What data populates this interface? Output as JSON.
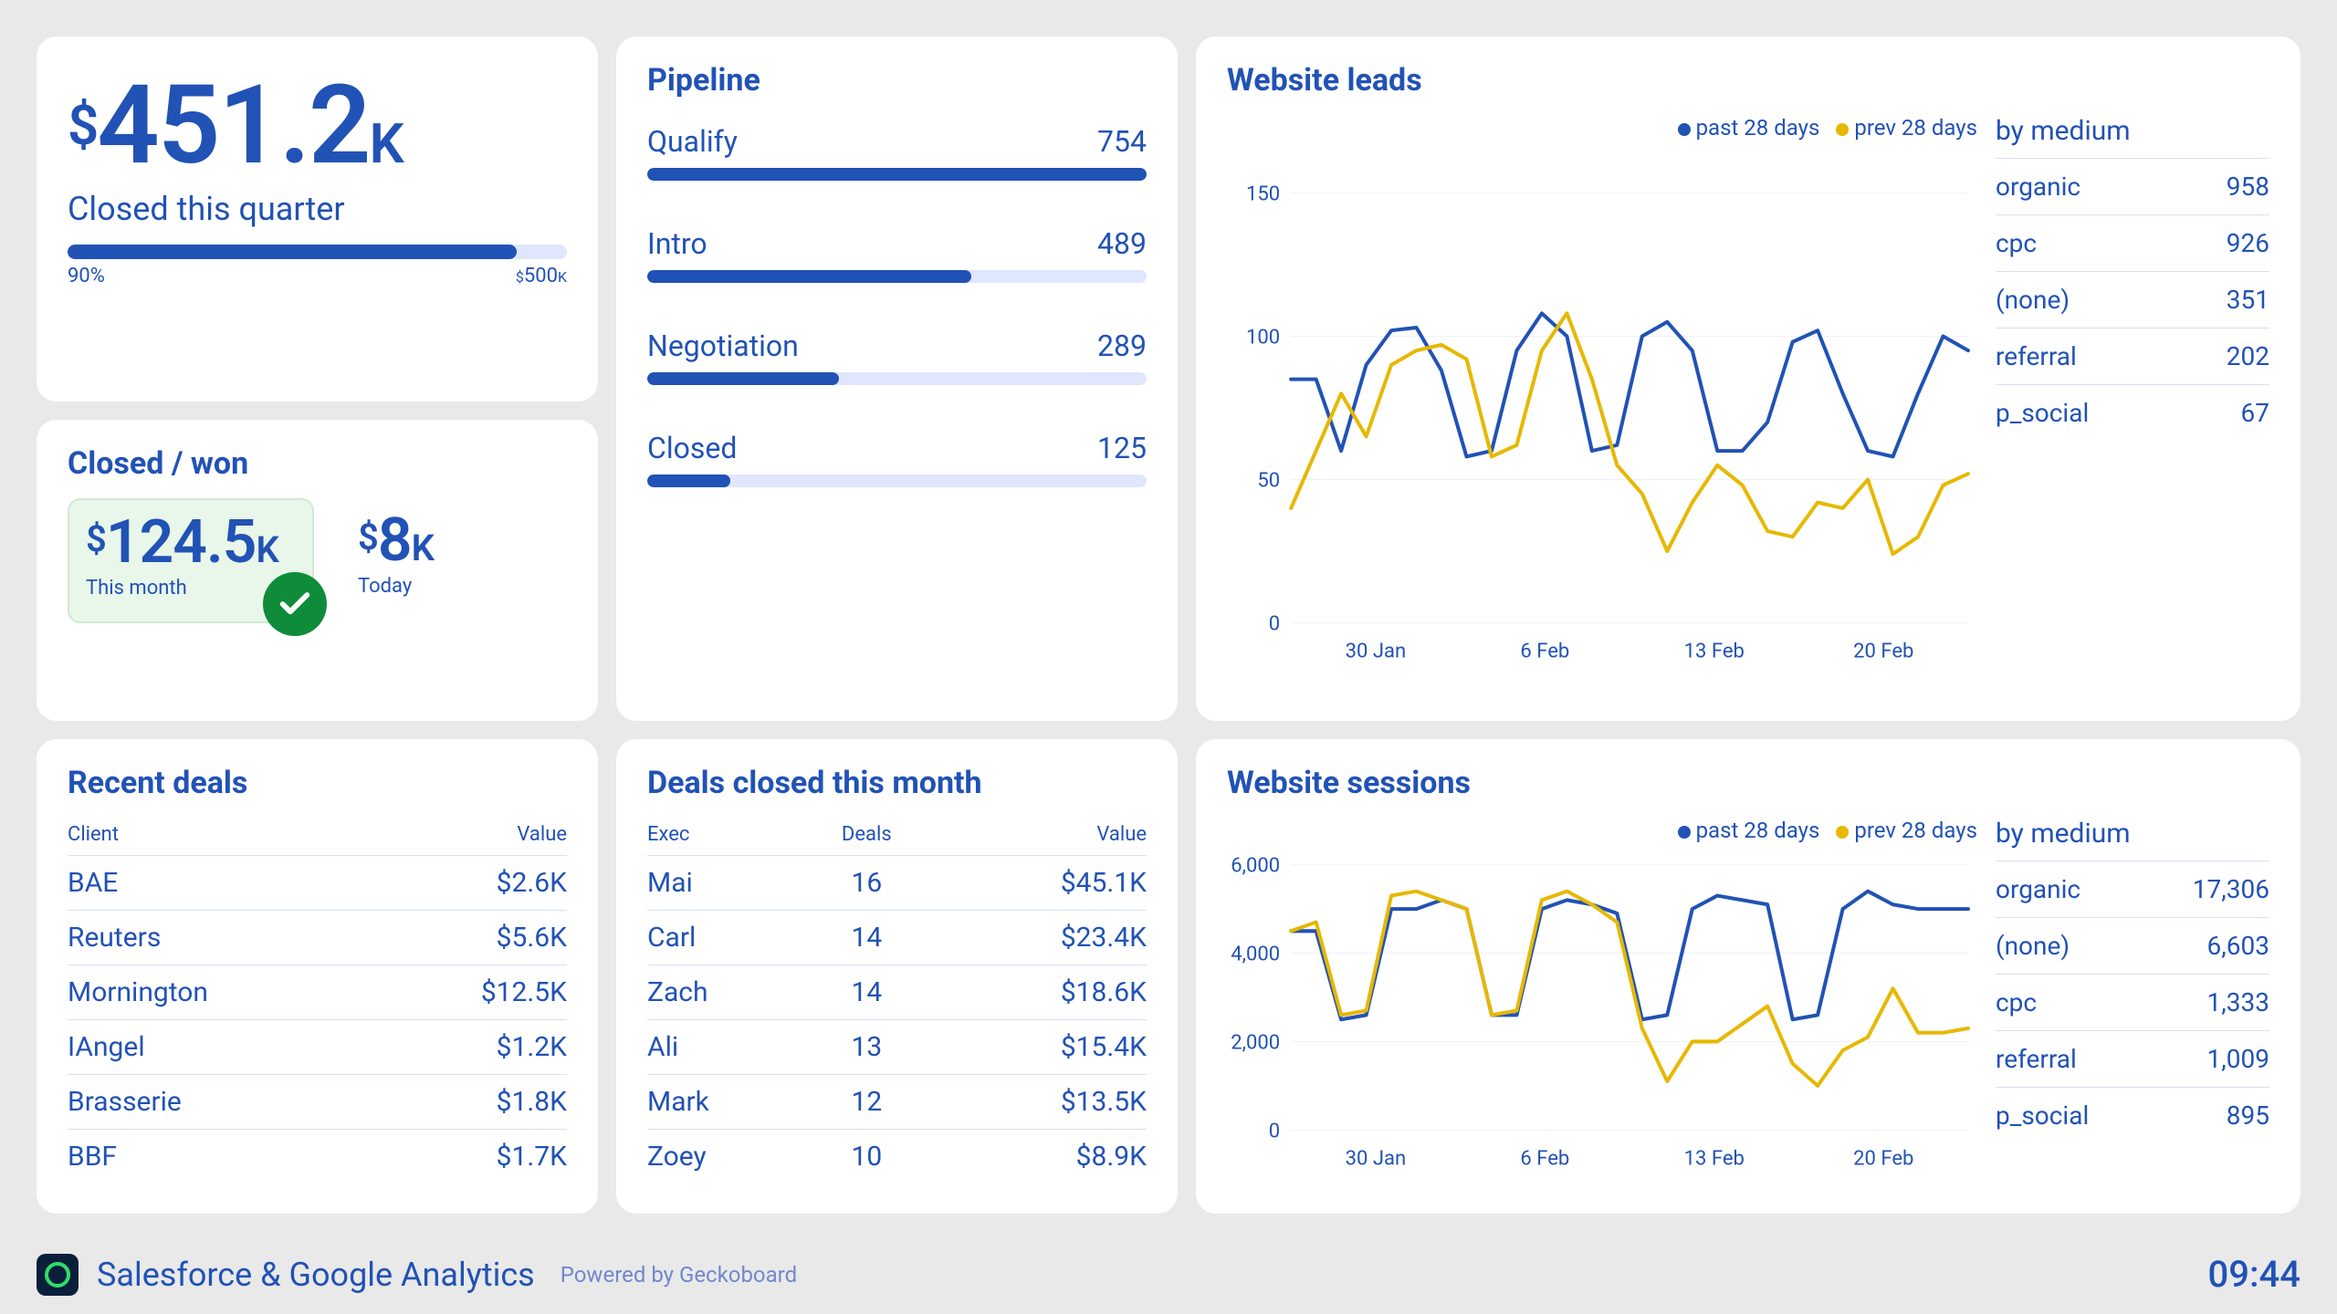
{
  "footer": {
    "title": "Salesforce & Google Analytics",
    "powered": "Powered by Geckoboard",
    "time": "09:44"
  },
  "quarter": {
    "prefix": "$",
    "value": "451.2",
    "suffix": "K",
    "caption": "Closed this quarter",
    "progress_pct": 90,
    "left_label": "90%",
    "right_prefix": "$",
    "right_value": "500",
    "right_suffix": "K"
  },
  "closed_won": {
    "title": "Closed / won",
    "month": {
      "prefix": "$",
      "value": "124.5",
      "suffix": "K",
      "label": "This month"
    },
    "today": {
      "prefix": "$",
      "value": "8",
      "suffix": "K",
      "label": "Today"
    }
  },
  "recent": {
    "title": "Recent deals",
    "columns": [
      "Client",
      "Value"
    ],
    "rows": [
      {
        "client": "BAE",
        "value": "$2.6K"
      },
      {
        "client": "Reuters",
        "value": "$5.6K"
      },
      {
        "client": "Mornington",
        "value": "$12.5K"
      },
      {
        "client": "IAngel",
        "value": "$1.2K"
      },
      {
        "client": "Brasserie",
        "value": "$1.8K"
      },
      {
        "client": "BBF",
        "value": "$1.7K"
      }
    ]
  },
  "pipeline": {
    "title": "Pipeline",
    "max": 754,
    "rows": [
      {
        "name": "Qualify",
        "value": 754
      },
      {
        "name": "Intro",
        "value": 489
      },
      {
        "name": "Negotiation",
        "value": 289
      },
      {
        "name": "Closed",
        "value": 125
      }
    ]
  },
  "execs": {
    "title": "Deals closed this month",
    "columns": [
      "Exec",
      "Deals",
      "Value"
    ],
    "rows": [
      {
        "exec": "Mai",
        "deals": 16,
        "value": "$45.1K"
      },
      {
        "exec": "Carl",
        "deals": 14,
        "value": "$23.4K"
      },
      {
        "exec": "Zach",
        "deals": 14,
        "value": "$18.6K"
      },
      {
        "exec": "Ali",
        "deals": 13,
        "value": "$15.4K"
      },
      {
        "exec": "Mark",
        "deals": 12,
        "value": "$13.5K"
      },
      {
        "exec": "Zoey",
        "deals": 10,
        "value": "$8.9K"
      }
    ]
  },
  "leads": {
    "title": "Website leads",
    "legend": {
      "a": "past 28 days",
      "b": "prev 28 days"
    },
    "ylim": [
      0,
      150
    ],
    "yticks": [
      0,
      50,
      100,
      150
    ],
    "xticks": [
      "30 Jan",
      "6 Feb",
      "13 Feb",
      "20 Feb"
    ],
    "by_medium_title": "by medium",
    "by_medium": [
      {
        "name": "organic",
        "value": "958"
      },
      {
        "name": "cpc",
        "value": "926"
      },
      {
        "name": "(none)",
        "value": "351"
      },
      {
        "name": "referral",
        "value": "202"
      },
      {
        "name": "p_social",
        "value": "67"
      }
    ]
  },
  "sessions": {
    "title": "Website sessions",
    "legend": {
      "a": "past 28 days",
      "b": "prev 28 days"
    },
    "ylim": [
      0,
      6000
    ],
    "yticks": [
      0,
      2000,
      4000,
      6000
    ],
    "xticks": [
      "30 Jan",
      "6 Feb",
      "13 Feb",
      "20 Feb"
    ],
    "by_medium_title": "by medium",
    "by_medium": [
      {
        "name": "organic",
        "value": "17,306"
      },
      {
        "name": "(none)",
        "value": "6,603"
      },
      {
        "name": "cpc",
        "value": "1,333"
      },
      {
        "name": "referral",
        "value": "1,009"
      },
      {
        "name": "p_social",
        "value": "895"
      }
    ]
  },
  "chart_data": [
    {
      "id": "website_leads",
      "type": "line",
      "title": "Website leads",
      "xlabel": "",
      "ylabel": "",
      "ylim": [
        0,
        150
      ],
      "x_tick_labels": [
        "30 Jan",
        "6 Feb",
        "13 Feb",
        "20 Feb"
      ],
      "x": [
        0,
        1,
        2,
        3,
        4,
        5,
        6,
        7,
        8,
        9,
        10,
        11,
        12,
        13,
        14,
        15,
        16,
        17,
        18,
        19,
        20,
        21,
        22,
        23,
        24,
        25,
        26,
        27
      ],
      "series": [
        {
          "name": "past 28 days",
          "color": "#2152b5",
          "values": [
            85,
            85,
            60,
            90,
            102,
            103,
            88,
            58,
            60,
            95,
            108,
            100,
            60,
            62,
            100,
            105,
            95,
            60,
            60,
            70,
            98,
            102,
            80,
            60,
            58,
            80,
            100,
            95
          ]
        },
        {
          "name": "prev 28 days",
          "color": "#e6b800",
          "values": [
            40,
            60,
            80,
            65,
            90,
            95,
            97,
            92,
            58,
            62,
            95,
            108,
            85,
            55,
            45,
            25,
            42,
            55,
            48,
            32,
            30,
            42,
            40,
            50,
            24,
            30,
            48,
            52
          ]
        }
      ]
    },
    {
      "id": "website_sessions",
      "type": "line",
      "title": "Website sessions",
      "xlabel": "",
      "ylabel": "",
      "ylim": [
        0,
        6000
      ],
      "x_tick_labels": [
        "30 Jan",
        "6 Feb",
        "13 Feb",
        "20 Feb"
      ],
      "x": [
        0,
        1,
        2,
        3,
        4,
        5,
        6,
        7,
        8,
        9,
        10,
        11,
        12,
        13,
        14,
        15,
        16,
        17,
        18,
        19,
        20,
        21,
        22,
        23,
        24,
        25,
        26,
        27
      ],
      "series": [
        {
          "name": "past 28 days",
          "color": "#2152b5",
          "values": [
            4500,
            4500,
            2500,
            2600,
            5000,
            5000,
            5200,
            5000,
            2600,
            2600,
            5000,
            5200,
            5100,
            4900,
            2500,
            2600,
            5000,
            5300,
            5200,
            5100,
            2500,
            2600,
            5000,
            5400,
            5100,
            5000,
            5000,
            5000
          ]
        },
        {
          "name": "prev 28 days",
          "color": "#e6b800",
          "values": [
            4500,
            4700,
            2600,
            2700,
            5300,
            5400,
            5200,
            5000,
            2600,
            2700,
            5200,
            5400,
            5100,
            4700,
            2300,
            1100,
            2000,
            2000,
            2400,
            2800,
            1500,
            1000,
            1800,
            2100,
            3200,
            2200,
            2200,
            2300
          ]
        }
      ]
    },
    {
      "id": "pipeline_bars",
      "type": "bar",
      "title": "Pipeline",
      "categories": [
        "Qualify",
        "Intro",
        "Negotiation",
        "Closed"
      ],
      "values": [
        754,
        489,
        289,
        125
      ]
    }
  ]
}
